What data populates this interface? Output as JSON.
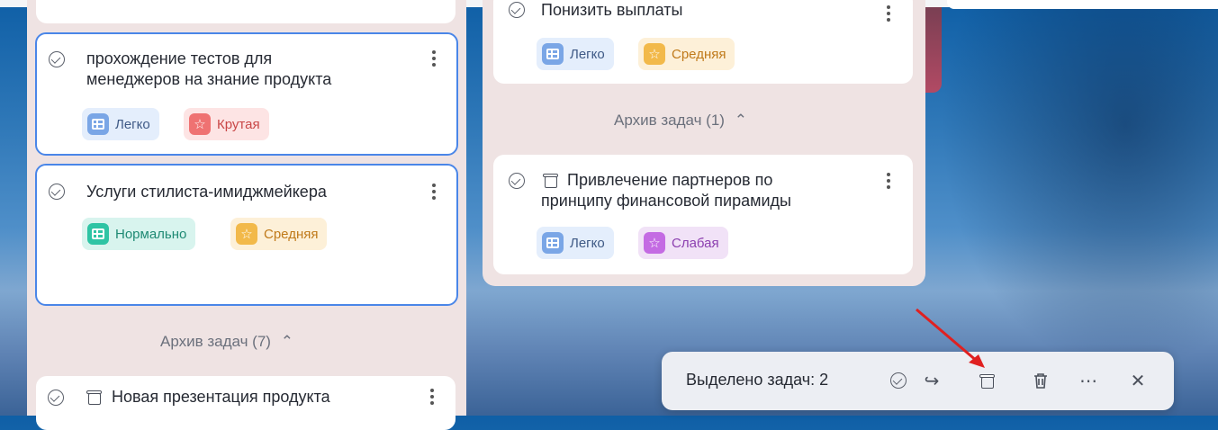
{
  "column1": {
    "cards": [
      {
        "title_line1": "прохождение тестов для",
        "title_line2": "менеджеров на знание продукта",
        "tags": [
          "Легко",
          "Крутая"
        ]
      },
      {
        "title_line1": "Услуги стилиста-имиджмейкера",
        "tags": [
          "Нормально",
          "Средняя"
        ]
      }
    ],
    "archive_header": "Архив задач (7)",
    "archived_card": {
      "title": "Новая презентация продукта"
    }
  },
  "column2": {
    "top_card": {
      "title": "Понизить выплаты",
      "tags": [
        "Легко",
        "Средняя"
      ]
    },
    "archive_header": "Архив задач (1)",
    "archived_card": {
      "title_line1": "Привлечение партнеров по",
      "title_line2": "принципу финансовой пирамиды",
      "tags": [
        "Легко",
        "Слабая"
      ]
    }
  },
  "toolbar": {
    "label": "Выделено задач: 2",
    "icons": [
      "check-circle-icon",
      "move-icon",
      "archive-icon",
      "trash-icon",
      "more-icon",
      "close-icon"
    ]
  },
  "colors": {
    "selection_border": "#4a86e8",
    "annotation_arrow": "#e02020"
  }
}
